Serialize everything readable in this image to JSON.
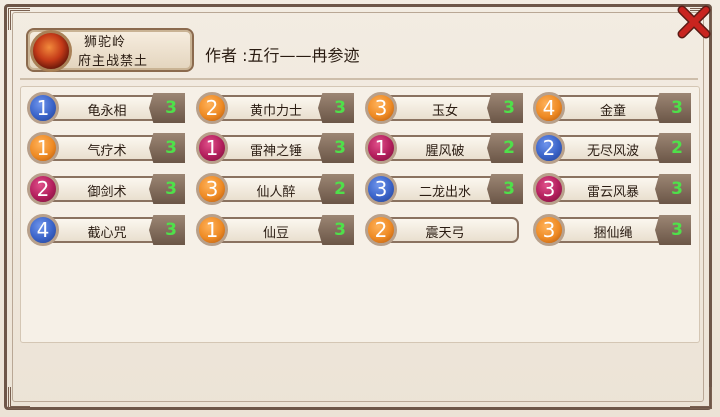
{
  "header": {
    "deck_name": "狮驼岭",
    "deck_sub": "府主战禁土",
    "author": "作者 :五行——冉参迹"
  },
  "colors": {
    "blue": "#3a63c8",
    "orange": "#ee8a24",
    "magenta": "#b21e5c",
    "count_green": "#4fe04a",
    "close_red": "#c8241f"
  },
  "icons": {
    "close": "close-icon",
    "avatar": "deck-avatar-icon"
  },
  "cards": [
    {
      "cost": "1",
      "color": "blue",
      "name": "龟永相",
      "count": "3"
    },
    {
      "cost": "2",
      "color": "orange",
      "name": "黄巾力士",
      "count": "3"
    },
    {
      "cost": "3",
      "color": "orange",
      "name": "玉女",
      "count": "3"
    },
    {
      "cost": "4",
      "color": "orange",
      "name": "金童",
      "count": "3"
    },
    {
      "cost": "1",
      "color": "orange",
      "name": "气疗术",
      "count": "3"
    },
    {
      "cost": "1",
      "color": "magenta",
      "name": "雷神之锤",
      "count": "3"
    },
    {
      "cost": "1",
      "color": "magenta",
      "name": "腥风破",
      "count": "2"
    },
    {
      "cost": "2",
      "color": "blue",
      "name": "无尽风波",
      "count": "2"
    },
    {
      "cost": "2",
      "color": "magenta",
      "name": "御剑术",
      "count": "3"
    },
    {
      "cost": "3",
      "color": "orange",
      "name": "仙人醉",
      "count": "2"
    },
    {
      "cost": "3",
      "color": "blue",
      "name": "二龙出水",
      "count": "3"
    },
    {
      "cost": "3",
      "color": "magenta",
      "name": "雷云风暴",
      "count": "3"
    },
    {
      "cost": "4",
      "color": "blue",
      "name": "截心咒",
      "count": "3"
    },
    {
      "cost": "1",
      "color": "orange",
      "name": "仙豆",
      "count": "3"
    },
    {
      "cost": "2",
      "color": "orange",
      "name": "震天弓",
      "count": ""
    },
    {
      "cost": "3",
      "color": "orange",
      "name": "捆仙绳",
      "count": "3"
    }
  ]
}
